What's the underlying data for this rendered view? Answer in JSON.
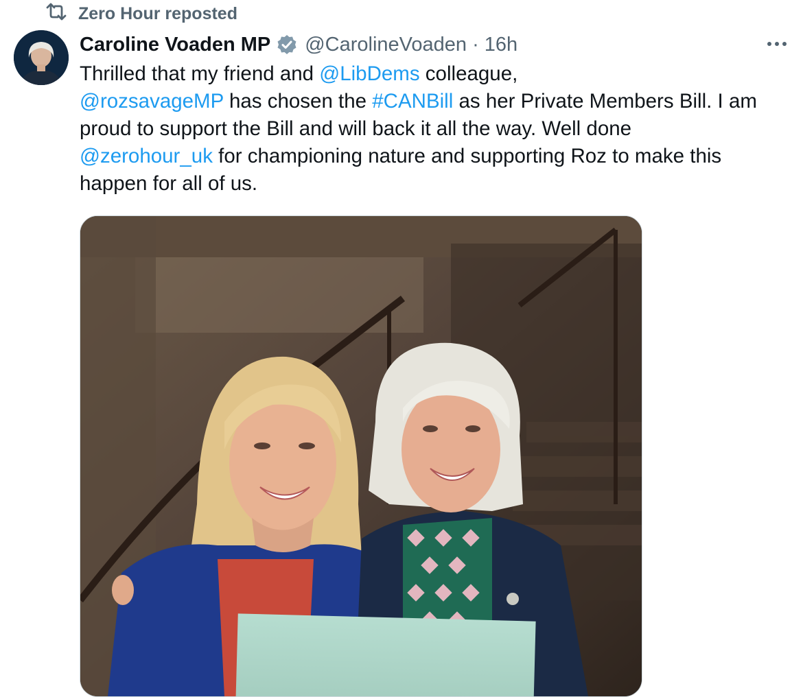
{
  "repost": {
    "icon": "repost-icon",
    "text": "Zero Hour reposted"
  },
  "author": {
    "name": "Caroline Voaden MP",
    "verified_icon": "verified-badge-icon",
    "handle": "@CarolineVoaden",
    "separator": "·",
    "time": "16h"
  },
  "tweet": {
    "line1": {
      "pre": "Thrilled that my friend and ",
      "mention1": "@LibDems",
      "post": " colleague,"
    },
    "line2": {
      "mention": "@rozsavageMP",
      "mid": " has chosen the ",
      "hashtag": "#CANBill",
      "post": " as her Private Members Bill. I am"
    },
    "line3": {
      "text": "proud to support the Bill and will back it all the way. Well done"
    },
    "line4": {
      "mention": "@zerohour_uk",
      "post": " for championing nature and supporting Roz to make this"
    },
    "line5": {
      "text": "happen for all of us."
    }
  },
  "media": {
    "description_icon": "photo-of-two-women-smiling"
  },
  "colors": {
    "link": "#1d9bf0",
    "secondary": "#536471",
    "verified": "#829aab"
  }
}
